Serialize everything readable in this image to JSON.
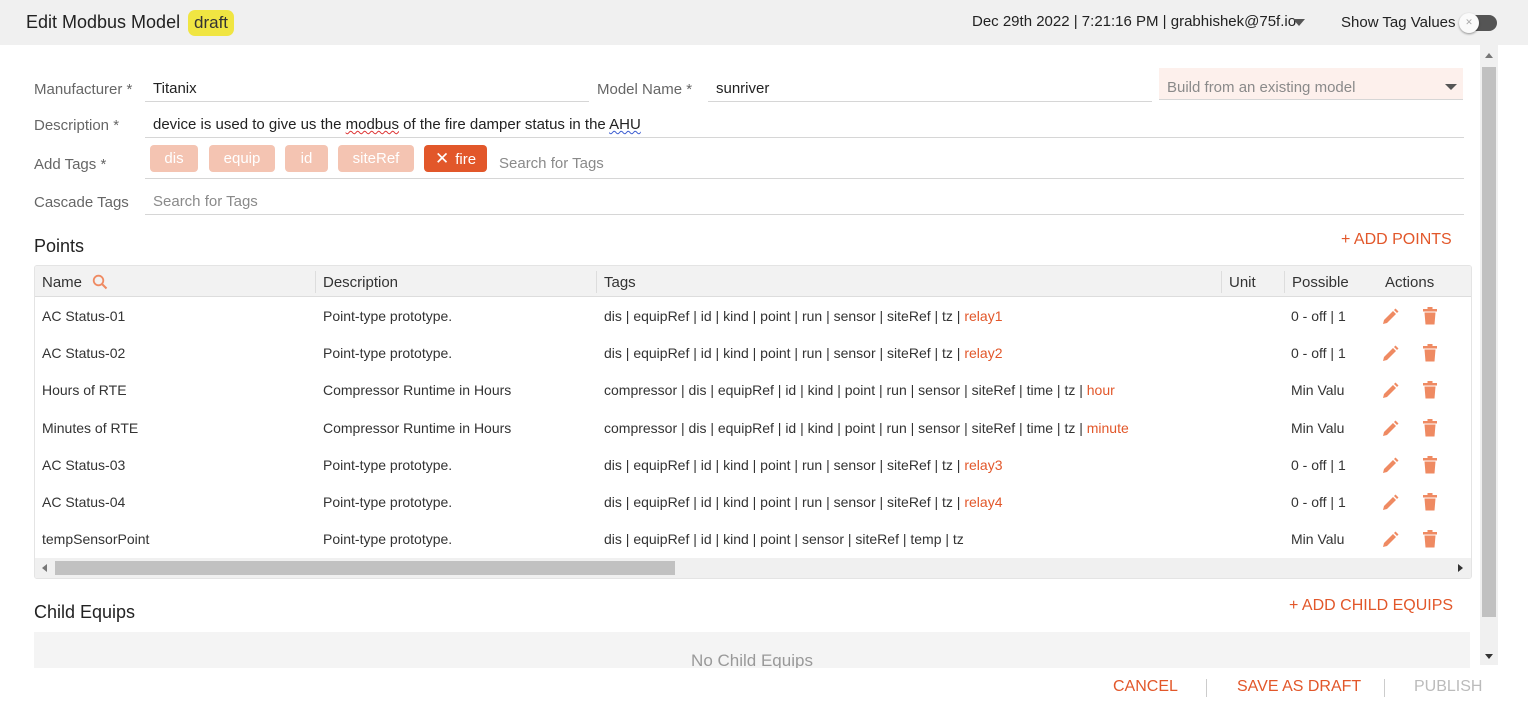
{
  "header": {
    "title": "Edit Modbus Model",
    "badge": "draft",
    "datetime_user": "Dec 29th 2022 | 7:21:16 PM | grabhishek@75f.io",
    "show_tag_values_label": "Show Tag Values",
    "show_tag_values_on": false
  },
  "form": {
    "manufacturer": {
      "label": "Manufacturer *",
      "value": "Titanix"
    },
    "model_name": {
      "label": "Model Name *",
      "value": "sunriver"
    },
    "build_from": {
      "placeholder": "Build from an existing model"
    },
    "description": {
      "label": "Description *",
      "value_parts": [
        "device is used to give us the ",
        "modbus",
        " of the fire damper status in the ",
        "AHU"
      ]
    },
    "add_tags": {
      "label": "Add Tags *",
      "tags": [
        "dis",
        "equip",
        "id",
        "siteRef"
      ],
      "active_tag": "fire",
      "search_placeholder": "Search for Tags"
    },
    "cascade_tags": {
      "label": "Cascade Tags",
      "search_placeholder": "Search for Tags"
    }
  },
  "points": {
    "title": "Points",
    "add_label": "+ ADD POINTS",
    "columns": [
      "Name",
      "Description",
      "Tags",
      "Unit",
      "Possible",
      "Actions"
    ],
    "rows": [
      {
        "name": "AC Status-01",
        "description": "Point-type prototype.",
        "tags": "dis | equipRef | id | kind | point | run | sensor | siteRef | tz | ",
        "tag_highlight": "relay1",
        "unit": "",
        "possible": "0 - off | 1"
      },
      {
        "name": "AC Status-02",
        "description": "Point-type prototype.",
        "tags": "dis | equipRef | id | kind | point | run | sensor | siteRef | tz | ",
        "tag_highlight": "relay2",
        "unit": "",
        "possible": "0 - off | 1"
      },
      {
        "name": "Hours of RTE",
        "description": "Compressor Runtime in Hours",
        "tags": "compressor | dis | equipRef | id | kind | point | run | sensor | siteRef | time | tz | ",
        "tag_highlight": "hour",
        "unit": "",
        "possible": "Min Valu"
      },
      {
        "name": "Minutes of RTE",
        "description": "Compressor Runtime in Hours",
        "tags": "compressor | dis | equipRef | id | kind | point | run | sensor | siteRef | time | tz | ",
        "tag_highlight": "minute",
        "unit": "",
        "possible": "Min Valu"
      },
      {
        "name": "AC Status-03",
        "description": "Point-type prototype.",
        "tags": "dis | equipRef | id | kind | point | run | sensor | siteRef | tz | ",
        "tag_highlight": "relay3",
        "unit": "",
        "possible": "0 - off | 1"
      },
      {
        "name": "AC Status-04",
        "description": "Point-type prototype.",
        "tags": "dis | equipRef | id | kind | point | run | sensor | siteRef | tz | ",
        "tag_highlight": "relay4",
        "unit": "",
        "possible": "0 - off | 1"
      },
      {
        "name": "tempSensorPoint",
        "description": "Point-type prototype.",
        "tags": "dis | equipRef | id | kind | point | sensor | siteRef | temp | tz",
        "tag_highlight": "",
        "unit": "",
        "possible": "Min Valu"
      }
    ]
  },
  "child_equips": {
    "title": "Child Equips",
    "add_label": "+ ADD CHILD EQUIPS",
    "empty_text": "No Child Equips"
  },
  "footer": {
    "cancel": "CANCEL",
    "save_draft": "SAVE AS DRAFT",
    "publish": "PUBLISH"
  },
  "colors": {
    "accent": "#e2572a",
    "chip": "#f4c4b2",
    "badge": "#f0e542"
  },
  "icons": {
    "user_menu": "chevron-down-icon",
    "name_search": "search-icon",
    "edit": "pencil-icon",
    "delete": "trash-icon",
    "remove_tag": "close-icon"
  }
}
